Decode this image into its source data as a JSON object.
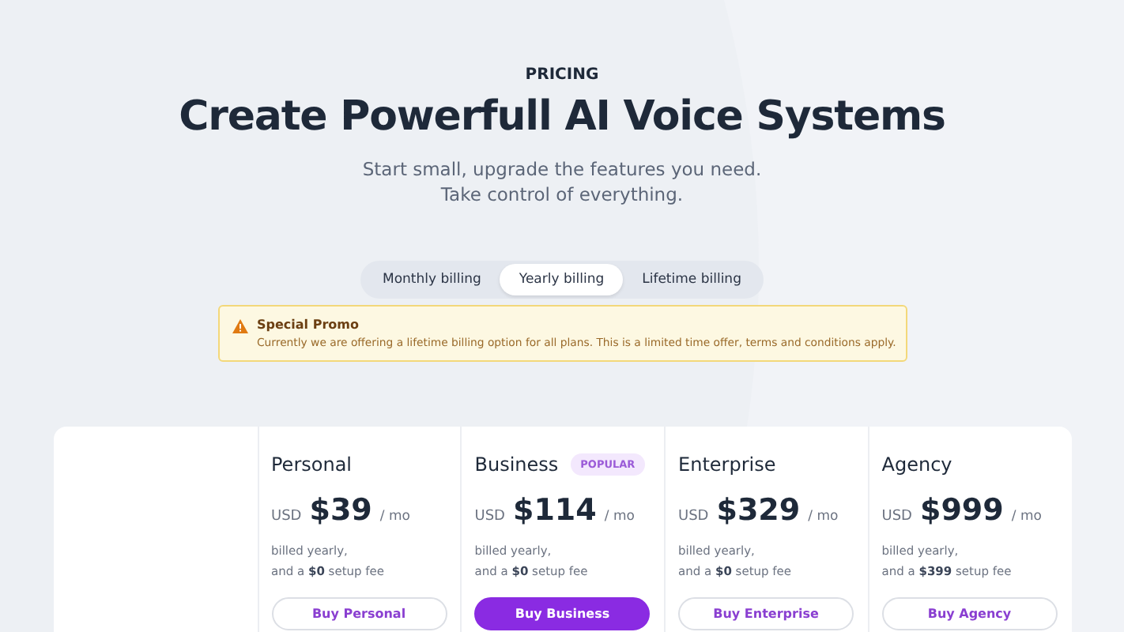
{
  "eyebrow": "PRICING",
  "title": "Create Powerfull AI Voice Systems",
  "subtitle": [
    "Start small, upgrade the features you need.",
    "Take control of everything."
  ],
  "billing_tabs": [
    {
      "label": "Monthly billing",
      "selected": false
    },
    {
      "label": "Yearly billing",
      "selected": true
    },
    {
      "label": "Lifetime billing",
      "selected": false
    }
  ],
  "promo": {
    "title": "Special Promo",
    "text": "Currently we are offering a lifetime billing option for all plans. This is a limited time offer, terms and conditions apply."
  },
  "plans": [
    {
      "name": "Personal",
      "currency": "USD",
      "price": "$39",
      "period": "/ mo",
      "billing": "billed yearly,",
      "fee": "and a **$0** setup fee",
      "button": "Buy Personal",
      "featured": false
    },
    {
      "name": "Business",
      "badge": "POPULAR",
      "currency": "USD",
      "price": "$114",
      "period": "/ mo",
      "billing": "billed yearly,",
      "fee": "and a **$0** setup fee",
      "button": "Buy Business",
      "featured": true
    },
    {
      "name": "Enterprise",
      "currency": "USD",
      "price": "$329",
      "period": "/ mo",
      "billing": "billed yearly,",
      "fee": "and a **$0** setup fee",
      "button": "Buy Enterprise",
      "featured": false
    },
    {
      "name": "Agency",
      "currency": "USD",
      "price": "$999",
      "period": "/ mo",
      "billing": "billed yearly,",
      "fee": "and a **$399** setup fee",
      "button": "Buy Agency",
      "featured": false
    }
  ]
}
